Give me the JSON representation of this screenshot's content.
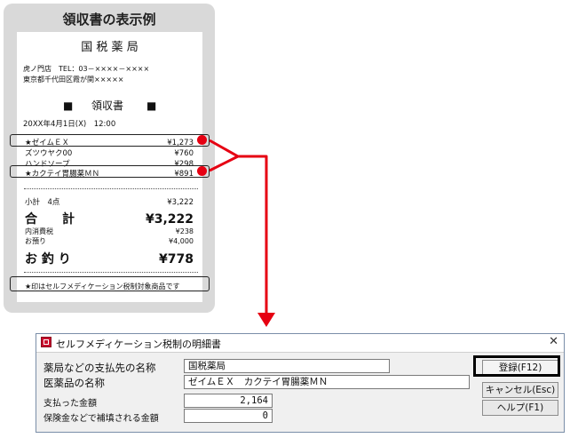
{
  "panel": {
    "title": "領収書の表示例"
  },
  "receipt": {
    "store_name": "国 税 薬 局",
    "address_line1": "虎ノ門店　TEL：03－××××－××××",
    "address_line2": "東京都千代田区霞が関×××××",
    "heading_left": "■",
    "heading": "領収書",
    "heading_right": "■",
    "datetime": "20XX年4月1日(X)　12:00",
    "items": [
      {
        "name": "★ゼイムＥＸ",
        "price": "¥1,273"
      },
      {
        "name": "ズツウヤク00",
        "price": "¥760"
      },
      {
        "name": "ハンドソープ",
        "price": "¥298"
      },
      {
        "name": "★カクテイ胃腸薬ＭＮ",
        "price": "¥891"
      }
    ],
    "subtotal_label": "小計　4点",
    "subtotal_value": "¥3,222",
    "total_label": "合　　計",
    "total_value": "¥3,222",
    "tax_label": "内消費税",
    "tax_value": "¥238",
    "deposit_label": "お預り",
    "deposit_value": "¥4,000",
    "change_label": "お 釣 り",
    "change_value": "¥778",
    "footer_note": "★印はセルフメディケーション税制対象商品です"
  },
  "dialog": {
    "title": "セルフメディケーション税制の明細書",
    "labels": {
      "payee": "薬局などの支払先の名称",
      "drug": "医薬品の名称",
      "paid": "支払った金額",
      "insurance": "保険金などで補填される金額"
    },
    "values": {
      "payee": "国税薬局",
      "drug": "ゼイムＥＸ　カクテイ胃腸薬ＭＮ",
      "paid": "2,164",
      "insurance": "0"
    },
    "buttons": {
      "register": "登録(F12)",
      "cancel": "キャンセル(Esc)",
      "help": "ヘルプ(F1)"
    },
    "close_glyph": "✕"
  },
  "colors": {
    "highlight_red": "#e60012",
    "receipt_panel": "#d9d9d9"
  }
}
